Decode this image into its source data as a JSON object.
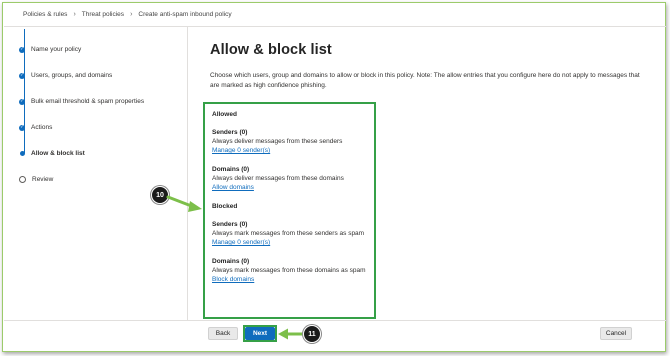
{
  "breadcrumb": [
    "Policies & rules",
    "Threat policies",
    "Create anti-spam inbound policy"
  ],
  "steps": [
    {
      "label": "Name your policy",
      "state": "done"
    },
    {
      "label": "Users, groups, and domains",
      "state": "done"
    },
    {
      "label": "Bulk email threshold & spam properties",
      "state": "done"
    },
    {
      "label": "Actions",
      "state": "done"
    },
    {
      "label": "Allow & block list",
      "state": "current"
    },
    {
      "label": "Review",
      "state": "pending"
    }
  ],
  "main": {
    "title": "Allow & block list",
    "description": "Choose which users, group and domains to allow or block in this policy. Note: The allow entries that you configure here do not apply to messages that are marked as high confidence phishing.",
    "allowed": {
      "heading": "Allowed",
      "senders": {
        "title": "Senders (0)",
        "text": "Always deliver messages from these senders",
        "link": "Manage 0 sender(s)"
      },
      "domains": {
        "title": "Domains (0)",
        "text": "Always deliver messages from these domains",
        "link": "Allow domains"
      }
    },
    "blocked": {
      "heading": "Blocked",
      "senders": {
        "title": "Senders (0)",
        "text": "Always mark messages from these senders as spam",
        "link": "Manage 0 sender(s)"
      },
      "domains": {
        "title": "Domains (0)",
        "text": "Always mark messages from these domains as spam",
        "link": "Block domains"
      }
    }
  },
  "callouts": {
    "first": "10",
    "second": "11"
  },
  "footer": {
    "back": "Back",
    "next": "Next",
    "cancel": "Cancel"
  },
  "colors": {
    "accent": "#0f6cbd",
    "highlight": "#35a047"
  }
}
